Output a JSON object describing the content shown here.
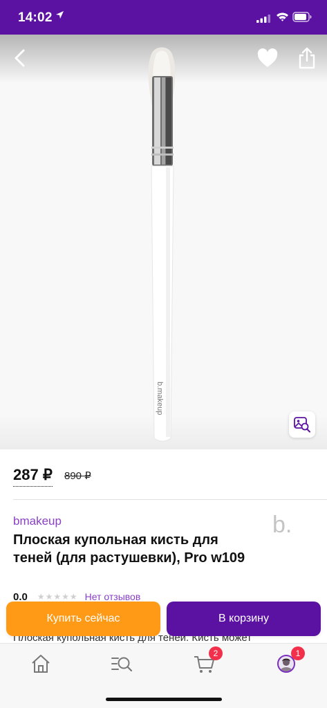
{
  "status_bar": {
    "time": "14:02",
    "bg_color": "#5b12a3"
  },
  "gallery": {
    "image_alt": "b.makeup",
    "brush_print": "b.makeup",
    "icons": {
      "back": "chevron-left-icon",
      "favorite": "heart-icon",
      "share": "share-icon",
      "visual_search": "image-search-icon"
    }
  },
  "price": {
    "current": "287 ₽",
    "old": "890 ₽"
  },
  "product": {
    "brand": "bmakeup",
    "brand_logo": "b.",
    "title": "Плоская купольная кисть для теней (для растушевки), Pro w109",
    "rating": "0.0",
    "stars": "★★★★★",
    "reviews": "Нет отзывов",
    "description_peek": "Плоская купольная кисть для теней. Кисть может"
  },
  "actions": {
    "buy_now": "Купить сейчас",
    "add_to_cart": "В корзину",
    "buy_color": "#ff9a17",
    "cart_color": "#5b12a3"
  },
  "tabs": [
    {
      "icon": "home-icon"
    },
    {
      "icon": "catalog-search-icon"
    },
    {
      "icon": "cart-icon",
      "badge": "2"
    },
    {
      "icon": "profile-avatar-icon",
      "badge": "1"
    }
  ]
}
